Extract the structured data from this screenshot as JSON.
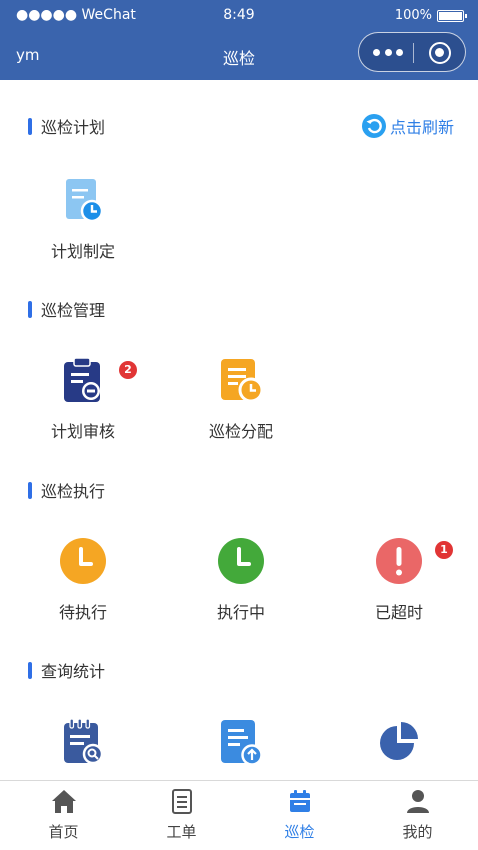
{
  "status_bar": {
    "carrier": "●●●●● WeChat",
    "time": "8:49",
    "battery": "100%"
  },
  "nav": {
    "user": "ym",
    "title": "巡检"
  },
  "refresh_label": "点击刷新",
  "sections": {
    "plan": {
      "title": "巡检计划",
      "items": [
        {
          "label": "计划制定",
          "icon": "plan-doc-clock-icon"
        }
      ]
    },
    "manage": {
      "title": "巡检管理",
      "items": [
        {
          "label": "计划审核",
          "icon": "clipboard-review-icon",
          "badge": "2"
        },
        {
          "label": "巡检分配",
          "icon": "assign-doc-clock-icon"
        }
      ]
    },
    "execute": {
      "title": "巡检执行",
      "items": [
        {
          "label": "待执行",
          "icon": "clock-orange-icon"
        },
        {
          "label": "执行中",
          "icon": "clock-green-icon"
        },
        {
          "label": "已超时",
          "icon": "exclamation-red-icon",
          "badge": "1"
        }
      ]
    },
    "query": {
      "title": "查询统计",
      "items": [
        {
          "icon": "calendar-search-icon"
        },
        {
          "icon": "doc-upload-icon"
        },
        {
          "icon": "pie-chart-icon"
        }
      ]
    }
  },
  "tabbar": [
    {
      "label": "首页",
      "icon": "home-icon"
    },
    {
      "label": "工单",
      "icon": "list-doc-icon"
    },
    {
      "label": "巡检",
      "icon": "calendar-icon",
      "active": true
    },
    {
      "label": "我的",
      "icon": "user-icon"
    }
  ],
  "colors": {
    "header": "#3a64ad",
    "accent": "#2f7fe6",
    "badge": "#e13535",
    "orange": "#f5a623",
    "green": "#43a93a",
    "red": "#ea6767",
    "navy": "#273a86",
    "light_blue": "#8cc6f2"
  }
}
